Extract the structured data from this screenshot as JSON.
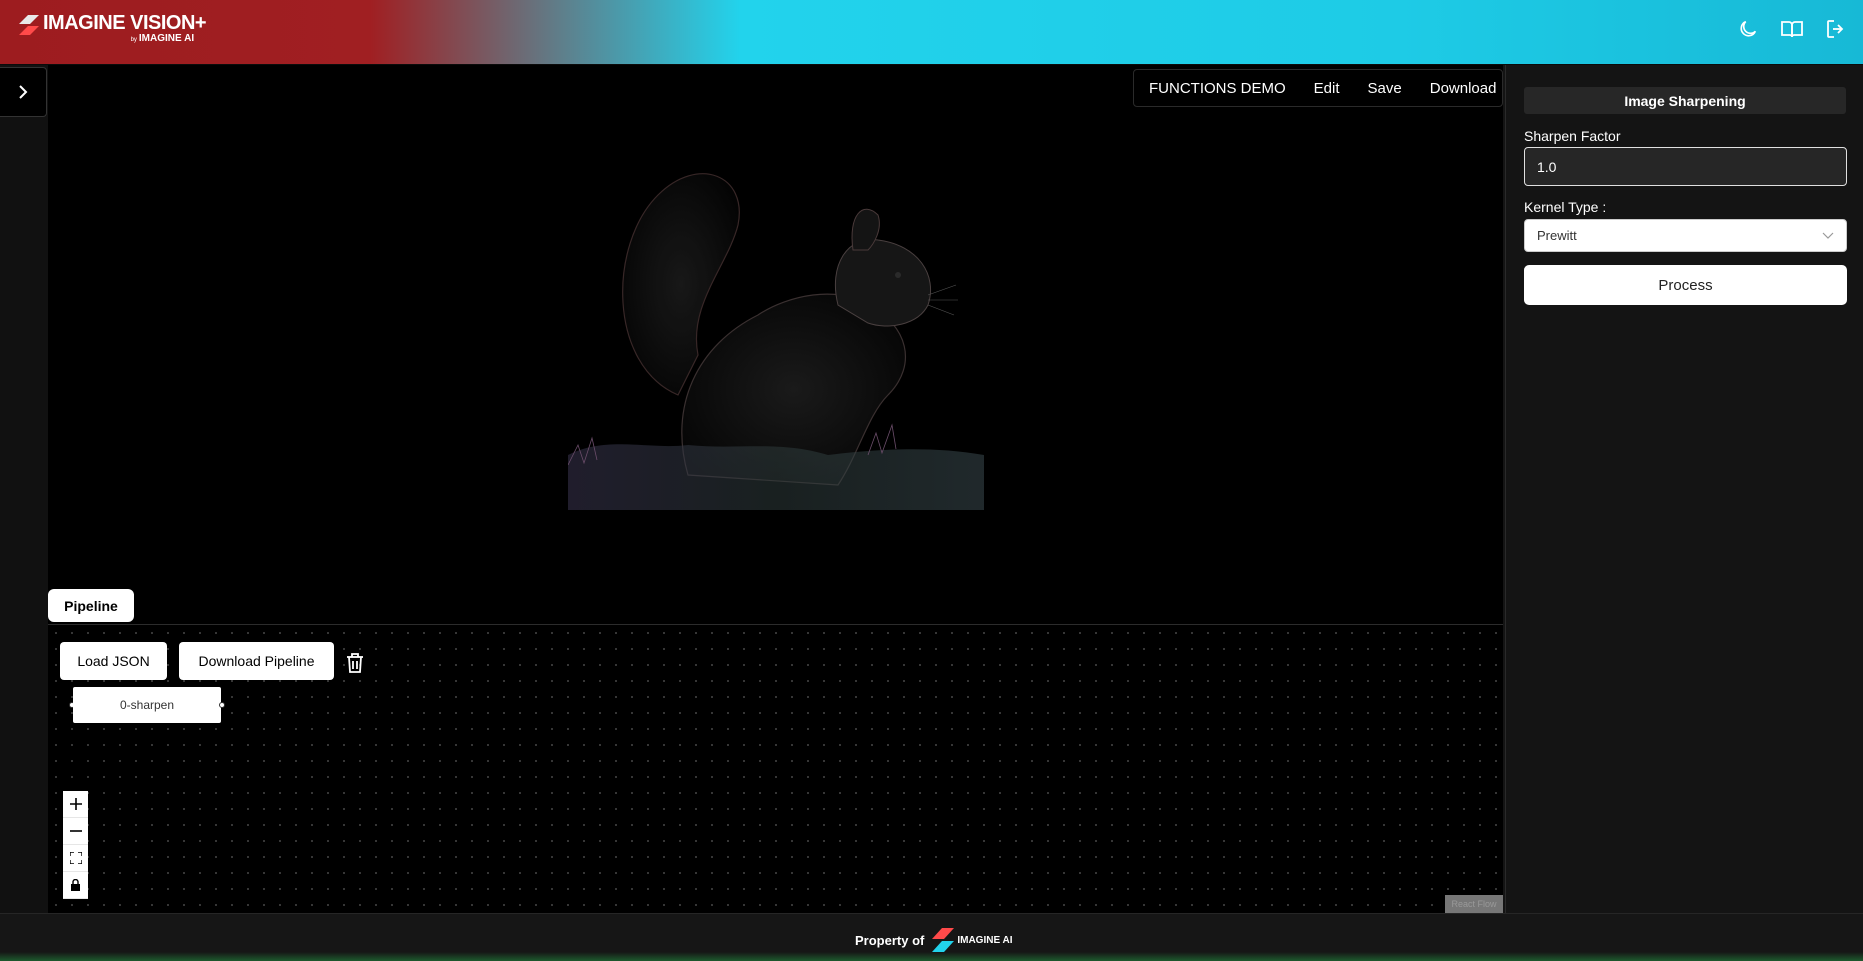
{
  "brand": {
    "name": "IMAGINE VISION+",
    "byline_prefix": "by",
    "byline": "IMAGINE AI",
    "colors": {
      "red": "#9d1c1f",
      "cyan": "#22d3ec"
    }
  },
  "header_icons": [
    "moon-icon",
    "book-icon",
    "logout-icon"
  ],
  "topbar": {
    "demo_label": "FUNCTIONS DEMO",
    "edit_label": "Edit",
    "save_label": "Save",
    "download_label": "Download"
  },
  "pipeline": {
    "tab_label": "Pipeline",
    "load_json_label": "Load JSON",
    "download_pipeline_label": "Download Pipeline",
    "node_label": "0-sharpen",
    "attribution": "React Flow"
  },
  "panel": {
    "title": "Image Sharpening",
    "sharpen_factor_label": "Sharpen Factor",
    "sharpen_factor_value": "1.0",
    "kernel_type_label": "Kernel Type :",
    "kernel_type_value": "Prewitt",
    "process_label": "Process"
  },
  "footer": {
    "property_label": "Property of",
    "logo_text": "IMAGINE AI"
  }
}
